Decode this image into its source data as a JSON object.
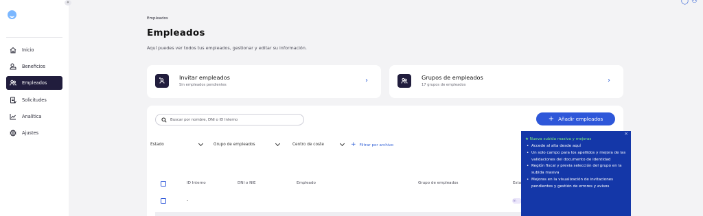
{
  "sidebar": {
    "collapse": "«",
    "items": [
      {
        "label": "Inicio",
        "icon": "home-icon"
      },
      {
        "label": "Beneficios",
        "icon": "benefits-icon"
      },
      {
        "label": "Empleados",
        "icon": "users-icon",
        "active": true
      },
      {
        "label": "Solicitudes",
        "icon": "requests-icon"
      },
      {
        "label": "Analítica",
        "icon": "analytics-icon"
      },
      {
        "label": "Ajustes",
        "icon": "settings-icon"
      }
    ]
  },
  "header": {
    "icons": [
      "help-icon",
      "user-icon"
    ],
    "breadcrumb": "Empleados",
    "title": "Empleados",
    "description": "Aquí puedes ver todos tus empleados, gestionar y editar su información."
  },
  "cards": {
    "invite": {
      "title": "Invitar empleados",
      "subtitle": "Sin empleados pendientes"
    },
    "groups": {
      "title": "Grupos de empleados",
      "subtitle": "17 grupos de empleados"
    }
  },
  "toolbar": {
    "search_placeholder": "Buscar por nombre, DNI o ID Interno",
    "add_button": "Añadir empleados"
  },
  "filters": {
    "estado": "Estado",
    "grupo": "Grupo de empleados",
    "centro": "Centro de coste",
    "file": "Filtrar por archivo"
  },
  "table": {
    "columns": [
      "ID Interno",
      "DNI o NIE",
      "Empleado",
      "Grupo de empleados",
      "Esta"
    ],
    "rows": [
      {
        "id": "-",
        "badge": "In"
      }
    ]
  },
  "tooltip": {
    "close": "×",
    "heading": "★ Nueva subida masiva y mejoras",
    "items": [
      "Accede al alta desde aquí",
      "Un solo campo para los apellidos y mejora de las validaciones del documento de identidad",
      "Región fiscal y previa selección del grupo en la subida masiva",
      "Mejoras en la visualización de invitaciones pendientes y gestión de errores y avisos"
    ]
  },
  "colors": {
    "sidebar_active": "#211d3d",
    "primary": "#2e57d9",
    "tooltip_bg": "#1437a8",
    "tooltip_heading": "#7ef07e"
  }
}
